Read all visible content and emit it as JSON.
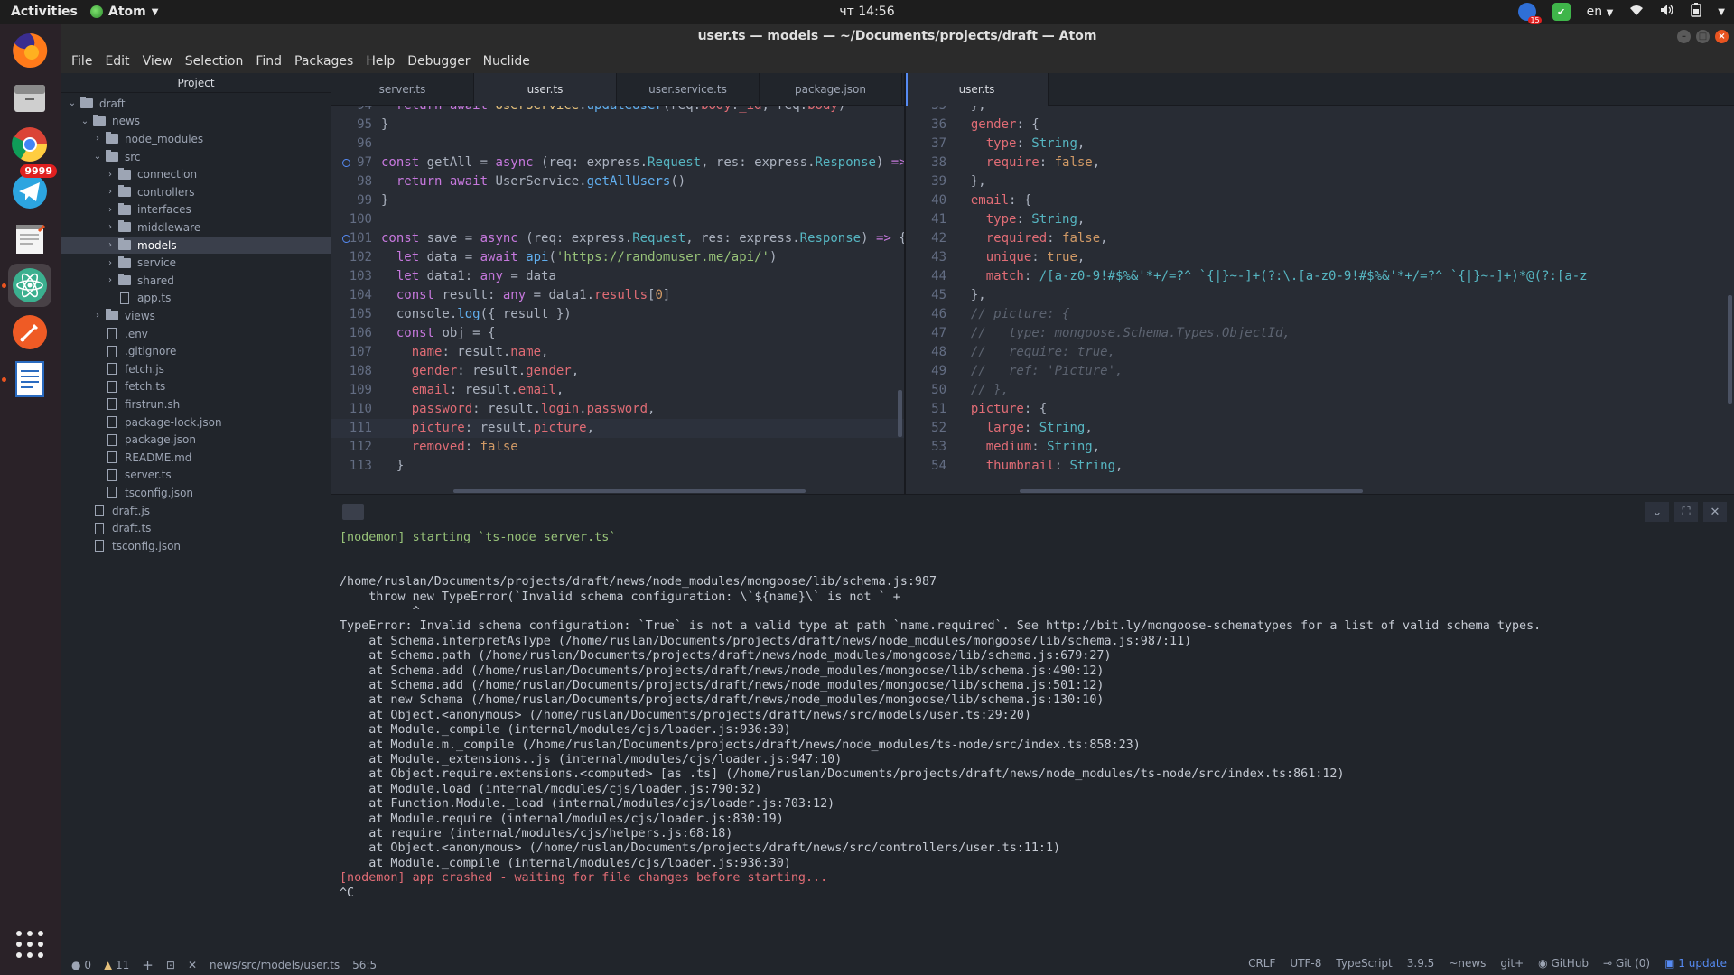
{
  "topbar": {
    "activities": "Activities",
    "app_name": "Atom",
    "clock": "чт 14:56",
    "lang": "en",
    "tray_badge": "15"
  },
  "dock": {
    "telegram_badge": "9999"
  },
  "window": {
    "title": "user.ts — models — ~/Documents/projects/draft — Atom"
  },
  "menu": [
    "File",
    "Edit",
    "View",
    "Selection",
    "Find",
    "Packages",
    "Help",
    "Debugger",
    "Nuclide"
  ],
  "tree": {
    "header": "Project",
    "items": [
      {
        "label": "draft",
        "depth": 0,
        "type": "folder",
        "open": true
      },
      {
        "label": "news",
        "depth": 1,
        "type": "folder",
        "open": true
      },
      {
        "label": "node_modules",
        "depth": 2,
        "type": "folder",
        "open": false
      },
      {
        "label": "src",
        "depth": 2,
        "type": "folder",
        "open": true
      },
      {
        "label": "connection",
        "depth": 3,
        "type": "folder",
        "open": false
      },
      {
        "label": "controllers",
        "depth": 3,
        "type": "folder",
        "open": false
      },
      {
        "label": "interfaces",
        "depth": 3,
        "type": "folder",
        "open": false
      },
      {
        "label": "middleware",
        "depth": 3,
        "type": "folder",
        "open": false
      },
      {
        "label": "models",
        "depth": 3,
        "type": "folder",
        "open": false,
        "selected": true
      },
      {
        "label": "service",
        "depth": 3,
        "type": "folder",
        "open": false
      },
      {
        "label": "shared",
        "depth": 3,
        "type": "folder",
        "open": false
      },
      {
        "label": "app.ts",
        "depth": 3,
        "type": "file"
      },
      {
        "label": "views",
        "depth": 2,
        "type": "folder",
        "open": false
      },
      {
        "label": ".env",
        "depth": 2,
        "type": "file"
      },
      {
        "label": ".gitignore",
        "depth": 2,
        "type": "file"
      },
      {
        "label": "fetch.js",
        "depth": 2,
        "type": "file"
      },
      {
        "label": "fetch.ts",
        "depth": 2,
        "type": "file"
      },
      {
        "label": "firstrun.sh",
        "depth": 2,
        "type": "file"
      },
      {
        "label": "package-lock.json",
        "depth": 2,
        "type": "file"
      },
      {
        "label": "package.json",
        "depth": 2,
        "type": "file"
      },
      {
        "label": "README.md",
        "depth": 2,
        "type": "file"
      },
      {
        "label": "server.ts",
        "depth": 2,
        "type": "file"
      },
      {
        "label": "tsconfig.json",
        "depth": 2,
        "type": "file"
      },
      {
        "label": "draft.js",
        "depth": 1,
        "type": "file"
      },
      {
        "label": "draft.ts",
        "depth": 1,
        "type": "file"
      },
      {
        "label": "tsconfig.json",
        "depth": 1,
        "type": "file"
      }
    ]
  },
  "left_tabs": [
    {
      "label": "server.ts",
      "active": false
    },
    {
      "label": "user.ts",
      "active": true
    },
    {
      "label": "user.service.ts",
      "active": false
    },
    {
      "label": "package.json",
      "active": false
    }
  ],
  "right_tabs": [
    {
      "label": "user.ts",
      "active": true
    }
  ],
  "left_code": [
    {
      "n": "94",
      "html": "  <span class='kw'>return await</span> <span class='ty'>UserService</span>.<span class='fn'>updateUser</span>(req.<span class='prop'>body</span>.<span class='prop'>_id</span>, req.<span class='prop'>body</span>)"
    },
    {
      "n": "95",
      "html": "}"
    },
    {
      "n": "96",
      "html": ""
    },
    {
      "n": "97",
      "html": "<span class='kw'>const</span> getAll = <span class='kw'>async</span> (req: express.<span class='cls'>Request</span>, res: express.<span class='cls'>Response</span>) <span class='kw'>=&gt;</span> {"
    },
    {
      "n": "98",
      "html": "  <span class='kw'>return await</span> UserService.<span class='fn'>getAllUsers</span>()"
    },
    {
      "n": "99",
      "html": "}"
    },
    {
      "n": "100",
      "html": ""
    },
    {
      "n": "101",
      "html": "<span class='kw'>const</span> save = <span class='kw'>async</span> (req: express.<span class='cls'>Request</span>, res: express.<span class='cls'>Response</span>) <span class='kw'>=&gt;</span> {"
    },
    {
      "n": "102",
      "html": "  <span class='kw'>let</span> data = <span class='kw'>await</span> <span class='fn'>api</span>(<span class='str'>'https://randomuser.me/api/'</span>)"
    },
    {
      "n": "103",
      "html": "  <span class='kw'>let</span> data1: <span class='kw'>any</span> = data"
    },
    {
      "n": "104",
      "html": "  <span class='kw'>const</span> result: <span class='kw'>any</span> = data1.<span class='prop'>results</span>[<span class='num'>0</span>]"
    },
    {
      "n": "105",
      "html": "  console.<span class='fn'>log</span>({ result })"
    },
    {
      "n": "106",
      "html": "  <span class='kw'>const</span> obj = {"
    },
    {
      "n": "107",
      "html": "    <span class='prop'>name</span>: result.<span class='prop'>name</span>,"
    },
    {
      "n": "108",
      "html": "    <span class='prop'>gender</span>: result.<span class='prop'>gender</span>,"
    },
    {
      "n": "109",
      "html": "    <span class='prop'>email</span>: result.<span class='prop'>email</span>,"
    },
    {
      "n": "110",
      "html": "    <span class='prop'>password</span>: result.<span class='prop'>login</span>.<span class='prop'>password</span>,"
    },
    {
      "n": "111",
      "html": "    <span class='prop'>picture</span>: result.<span class='prop'>picture</span>,",
      "cur": true
    },
    {
      "n": "112",
      "html": "    <span class='prop'>removed</span>: <span class='num'>false</span>"
    },
    {
      "n": "113",
      "html": "  }"
    }
  ],
  "right_code": [
    {
      "n": "35",
      "html": "  },"
    },
    {
      "n": "36",
      "html": "  <span class='prop'>gender</span>: {"
    },
    {
      "n": "37",
      "html": "    <span class='prop'>type</span>: <span class='cls'>String</span>,"
    },
    {
      "n": "38",
      "html": "    <span class='prop'>require</span>: <span class='num'>false</span>,"
    },
    {
      "n": "39",
      "html": "  },"
    },
    {
      "n": "40",
      "html": "  <span class='prop'>email</span>: {"
    },
    {
      "n": "41",
      "html": "    <span class='prop'>type</span>: <span class='cls'>String</span>,"
    },
    {
      "n": "42",
      "html": "    <span class='prop'>required</span>: <span class='num'>false</span>,"
    },
    {
      "n": "43",
      "html": "    <span class='prop'>unique</span>: <span class='num'>true</span>,"
    },
    {
      "n": "44",
      "html": "    <span class='prop'>match</span>: <span class='cls'>/[a-z0-9!#$%&amp;'*+/=?^_`{|}~-]+(?:\\.[a-z0-9!#$%&amp;'*+/=?^_`{|}~-]+)*@(?:[a-z</span>"
    },
    {
      "n": "45",
      "html": "  },"
    },
    {
      "n": "46",
      "html": "  <span class='cmt'>// picture: {</span>"
    },
    {
      "n": "47",
      "html": "  <span class='cmt'>//   type: mongoose.Schema.Types.ObjectId,</span>"
    },
    {
      "n": "48",
      "html": "  <span class='cmt'>//   require: true,</span>"
    },
    {
      "n": "49",
      "html": "  <span class='cmt'>//   ref: 'Picture',</span>"
    },
    {
      "n": "50",
      "html": "  <span class='cmt'>// },</span>"
    },
    {
      "n": "51",
      "html": "  <span class='prop'>picture</span>: {"
    },
    {
      "n": "52",
      "html": "    <span class='prop'>large</span>: <span class='cls'>String</span>,"
    },
    {
      "n": "53",
      "html": "    <span class='prop'>medium</span>: <span class='cls'>String</span>,"
    },
    {
      "n": "54",
      "html": "    <span class='prop'>thumbnail</span>: <span class='cls'>String</span>,"
    }
  ],
  "terminal": [
    {
      "t": "[nodemon] starting `ts-node server.ts`",
      "c": "#98c379"
    },
    {
      "t": "",
      "c": "#c5cad3"
    },
    {
      "t": "/home/ruslan/Documents/projects/draft/news/node_modules/mongoose/lib/schema.js:987",
      "c": "#c5cad3"
    },
    {
      "t": "    throw new TypeError(`Invalid schema configuration: \\`${name}\\` is not ` +",
      "c": "#c5cad3"
    },
    {
      "t": "          ^",
      "c": "#c5cad3"
    },
    {
      "t": "TypeError: Invalid schema configuration: `True` is not a valid type at path `name.required`. See http://bit.ly/mongoose-schematypes for a list of valid schema types.",
      "c": "#c5cad3"
    },
    {
      "t": "    at Schema.interpretAsType (/home/ruslan/Documents/projects/draft/news/node_modules/mongoose/lib/schema.js:987:11)",
      "c": "#c5cad3"
    },
    {
      "t": "    at Schema.path (/home/ruslan/Documents/projects/draft/news/node_modules/mongoose/lib/schema.js:679:27)",
      "c": "#c5cad3"
    },
    {
      "t": "    at Schema.add (/home/ruslan/Documents/projects/draft/news/node_modules/mongoose/lib/schema.js:490:12)",
      "c": "#c5cad3"
    },
    {
      "t": "    at Schema.add (/home/ruslan/Documents/projects/draft/news/node_modules/mongoose/lib/schema.js:501:12)",
      "c": "#c5cad3"
    },
    {
      "t": "    at new Schema (/home/ruslan/Documents/projects/draft/news/node_modules/mongoose/lib/schema.js:130:10)",
      "c": "#c5cad3"
    },
    {
      "t": "    at Object.<anonymous> (/home/ruslan/Documents/projects/draft/news/src/models/user.ts:29:20)",
      "c": "#c5cad3"
    },
    {
      "t": "    at Module._compile (internal/modules/cjs/loader.js:936:30)",
      "c": "#c5cad3"
    },
    {
      "t": "    at Module.m._compile (/home/ruslan/Documents/projects/draft/news/node_modules/ts-node/src/index.ts:858:23)",
      "c": "#c5cad3"
    },
    {
      "t": "    at Module._extensions..js (internal/modules/cjs/loader.js:947:10)",
      "c": "#c5cad3"
    },
    {
      "t": "    at Object.require.extensions.<computed> [as .ts] (/home/ruslan/Documents/projects/draft/news/node_modules/ts-node/src/index.ts:861:12)",
      "c": "#c5cad3"
    },
    {
      "t": "    at Module.load (internal/modules/cjs/loader.js:790:32)",
      "c": "#c5cad3"
    },
    {
      "t": "    at Function.Module._load (internal/modules/cjs/loader.js:703:12)",
      "c": "#c5cad3"
    },
    {
      "t": "    at Module.require (internal/modules/cjs/loader.js:830:19)",
      "c": "#c5cad3"
    },
    {
      "t": "    at require (internal/modules/cjs/helpers.js:68:18)",
      "c": "#c5cad3"
    },
    {
      "t": "    at Object.<anonymous> (/home/ruslan/Documents/projects/draft/news/src/controllers/user.ts:11:1)",
      "c": "#c5cad3"
    },
    {
      "t": "    at Module._compile (internal/modules/cjs/loader.js:936:30)",
      "c": "#c5cad3"
    },
    {
      "t": "[nodemon] app crashed - waiting for file changes before starting...",
      "c": "#e06c75"
    },
    {
      "t": "^C",
      "c": "#c5cad3"
    }
  ],
  "status": {
    "errors": "0",
    "warnings": "11",
    "path": "news/src/models/user.ts",
    "cursor": "56:5",
    "line_ending": "CRLF",
    "encoding": "UTF-8",
    "grammar": "TypeScript",
    "ts_version": "3.9.5",
    "project": "~news",
    "git_plus": "git+",
    "github": "GitHub",
    "git": "Git (0)",
    "update": "1 update"
  },
  "colors": {
    "accent": "#568af2",
    "error": "#e06c75",
    "success": "#98c379"
  }
}
